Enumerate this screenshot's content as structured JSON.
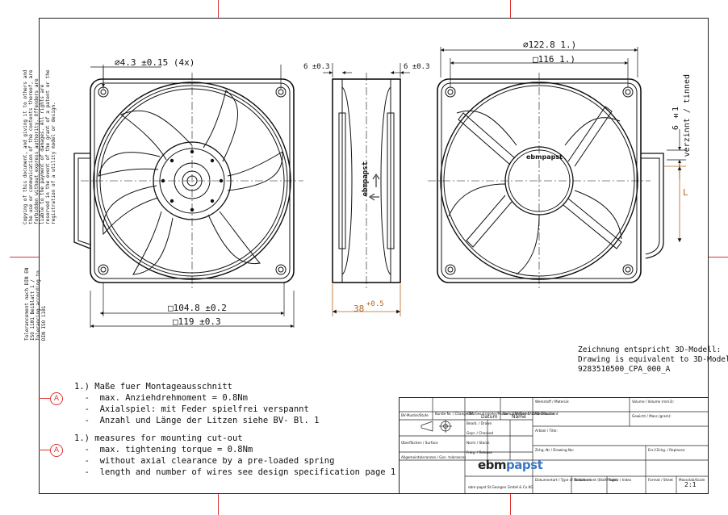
{
  "side_notes": {
    "copyright": "Copying of this document, and giving it to others and the use or communication of the contents thereof, are forbidden without express authority. Offenders are liable to the payment of damages. All rights are reserved in the event of the grant of a patent or the registration of a utility model or design.",
    "tolerance": "Tolerancement nach DIN EN ISO 1101 Beiblatt 1 / Tolerancing according to DIN ISO 1101"
  },
  "dimensions": {
    "hole_dia": "⌀4.3 ±0.15 (4x)",
    "face_width": "6 ±0.3",
    "face_width_right": "6 ±0.3",
    "outer_dia": "⌀122.8  1.)",
    "square_116": "□116  1.)",
    "square_104": "□104.8 ±0.2",
    "square_119": "□119 ±0.3",
    "depth": "38",
    "depth_tol": "+0.5",
    "tinned": "6 ±1",
    "tinned_label": "verzinnt / tinned",
    "wire_length": "L"
  },
  "brand_label_side": "ebmpapst",
  "brand_label_back": "ebmpapst",
  "notes_de": {
    "head": "1.) Maße fuer Montageausschnitt",
    "line1": "  -  max. Anziehdrehmoment = 0.8Nm",
    "line2": "  -  Axialspiel: mit Feder spielfrei verspannt",
    "line3": "  -  Anzahl und Länge der Litzen siehe BV- Bl. 1"
  },
  "notes_en": {
    "head": "1.) measures for mounting cut-out",
    "line1": "  -  max. tightening torque = 0.8Nm",
    "line2": "  -  without axial clearance by a pre-loaded spring",
    "line3": "  -  length and number of wires see design specification page 1"
  },
  "marker_label": "A",
  "model_note": {
    "line1": "Zeichnung entspricht 3D-Modell:",
    "line2": "Drawing is equivalent to 3D-Model:",
    "line3": "9283510500_CPA_000_A"
  },
  "title_block": {
    "c1": "BV-Muster/Stufe",
    "c2": "Kunde-Nr. / Change-No.",
    "c3": "CPA/Ges-Ersteller/Mutter / CPA/Ges-Ersteller-Muster",
    "c4": "Vor-Langeformt / CAD-Dokument",
    "datum": "Datum",
    "name": "Name",
    "bearb": "Bearb. / Drawn",
    "gepr": "Gepr. / Checked",
    "norm": "Norm / Stand.",
    "frei": "Freig. / Release",
    "oberfl": "Oberflächen / Surface",
    "allg_tol": "Allgemeintoleranzen / Gen. tolerances",
    "werkstoff": "Werkstoff / Material:",
    "artikel": "Artikel / Title:",
    "volume": "Volume / Volume (mm3):",
    "gewicht": "Gewicht / Mass (gram):",
    "zeichnr": "Zchg.-Nr / Drawing No:",
    "ersatz": "Ers.f.Zchg. / Replaces:",
    "dokument": "Dokumentart / Type of document",
    "teildokument": "Teildokument (Blatt/Page)",
    "index": "Index / Index",
    "format": "Format / Sheet",
    "massstab": "Massstab/Scale",
    "company": "ebm-papst St.Georgen GmbH & Co KG",
    "logo_ebm": "ebm",
    "logo_papst": "papst",
    "scale": "2:1"
  }
}
